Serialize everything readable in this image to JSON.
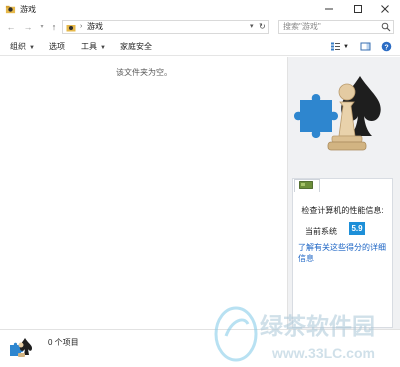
{
  "window": {
    "title": "游戏"
  },
  "address": {
    "path": "游戏",
    "separator": "›"
  },
  "search": {
    "placeholder": "搜索\"游戏\""
  },
  "toolbar": {
    "organize": "组织",
    "options": "选项",
    "tools": "工具",
    "parental": "家庭安全"
  },
  "content": {
    "empty_message": "该文件夹为空。"
  },
  "perf": {
    "title": "检查计算机的性能信息:",
    "label": "当前系统",
    "score": "5.9",
    "link": "了解有关这些得分的详细信息"
  },
  "status": {
    "items": "0 个项目"
  },
  "watermark": {
    "brand": "绿茶软件园",
    "url": "www.33LC.com"
  },
  "colors": {
    "accent": "#1d8fd8",
    "link": "#1a63c4",
    "pane": "#f0f1f3"
  },
  "icons": [
    "folder-icon",
    "back-arrow-icon",
    "forward-arrow-icon",
    "dropdown-icon",
    "up-arrow-icon",
    "refresh-icon",
    "search-icon",
    "view-icon",
    "pane-icon",
    "help-icon",
    "chess-puzzle-icon"
  ]
}
